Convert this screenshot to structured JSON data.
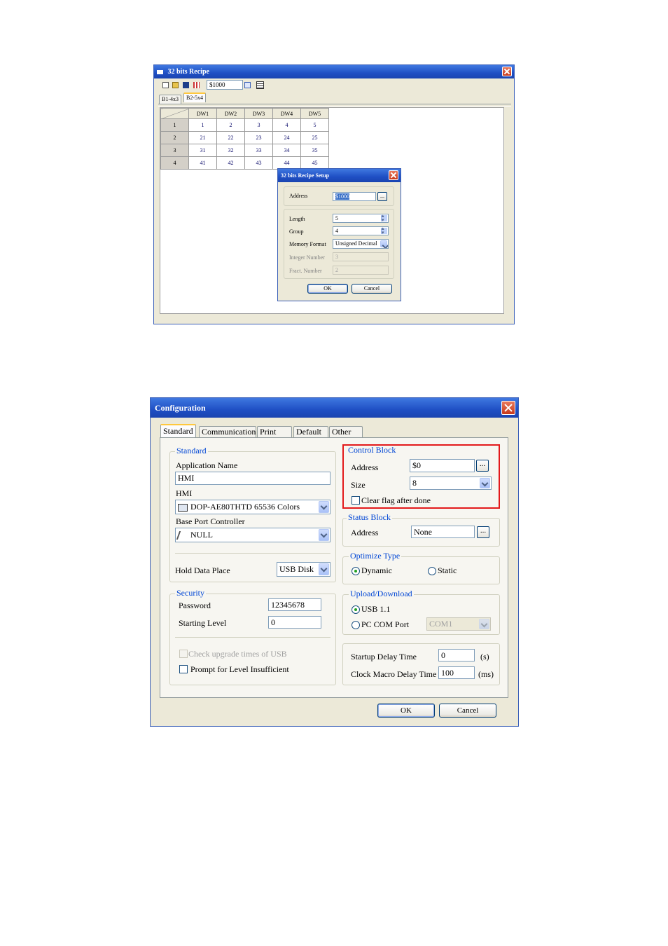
{
  "recipe_window": {
    "title": "32 bits Recipe",
    "address_value": "$1000",
    "tabs": [
      "B1-4x3",
      "B2-5x4"
    ],
    "columns": [
      "DW1",
      "DW2",
      "DW3",
      "DW4",
      "DW5"
    ],
    "rows": [
      {
        "label": "1",
        "values": [
          "1",
          "2",
          "3",
          "4",
          "5"
        ]
      },
      {
        "label": "2",
        "values": [
          "21",
          "22",
          "23",
          "24",
          "25"
        ]
      },
      {
        "label": "3",
        "values": [
          "31",
          "32",
          "33",
          "34",
          "35"
        ]
      },
      {
        "label": "4",
        "values": [
          "41",
          "42",
          "43",
          "44",
          "45"
        ]
      }
    ]
  },
  "recipe_setup": {
    "title": "32 bits Recipe Setup",
    "address_label": "Address",
    "address_value": "$1000",
    "length_label": "Length",
    "length_value": "5",
    "group_label": "Group",
    "group_value": "4",
    "memory_format_label": "Memory Format",
    "memory_format_value": "Unsigned Decimal",
    "integer_number_label": "Integer Number",
    "integer_number_value": "3",
    "fract_number_label": "Fract. Number",
    "fract_number_value": "2",
    "ok_label": "OK",
    "cancel_label": "Cancel",
    "dots_label": "..."
  },
  "configuration": {
    "title": "Configuration",
    "tabs": [
      "Standard",
      "Communication",
      "Print",
      "Default",
      "Other"
    ],
    "standard": {
      "group_label": "Standard",
      "app_name_label": "Application Name",
      "app_name_value": "HMI",
      "hmi_label": "HMI",
      "hmi_value": "DOP-AE80THTD 65536 Colors",
      "base_port_label": "Base Port Controller",
      "base_port_value": "NULL",
      "hold_data_label": "Hold Data Place",
      "hold_data_value": "USB Disk"
    },
    "security": {
      "group_label": "Security",
      "password_label": "Password",
      "password_value": "12345678",
      "starting_level_label": "Starting Level",
      "starting_level_value": "0"
    },
    "check_upgrade_label": "Check upgrade times of USB",
    "prompt_level_label": "Prompt for Level Insufficient",
    "control_block": {
      "group_label": "Control Block",
      "address_label": "Address",
      "address_value": "$0",
      "size_label": "Size",
      "size_value": "8",
      "clear_flag_label": "Clear flag after done"
    },
    "status_block": {
      "group_label": "Status Block",
      "address_label": "Address",
      "address_value": "None"
    },
    "optimize": {
      "group_label": "Optimize Type",
      "dynamic_label": "Dynamic",
      "static_label": "Static"
    },
    "upload": {
      "group_label": "Upload/Download",
      "usb_label": "USB 1.1",
      "pccom_label": "PC COM Port",
      "com_value": "COM1"
    },
    "delay": {
      "startup_label": "Startup Delay Time",
      "startup_value": "0",
      "startup_unit": "(s)",
      "clock_label": "Clock Macro Delay Time",
      "clock_value": "100",
      "clock_unit": "(ms)"
    },
    "ok_label": "OK",
    "cancel_label": "Cancel",
    "dots_label": "..."
  },
  "colors": {
    "highlight_border": "#e3191b",
    "title_blue": "#1f4fc4",
    "group_label_blue": "#0046d5"
  }
}
